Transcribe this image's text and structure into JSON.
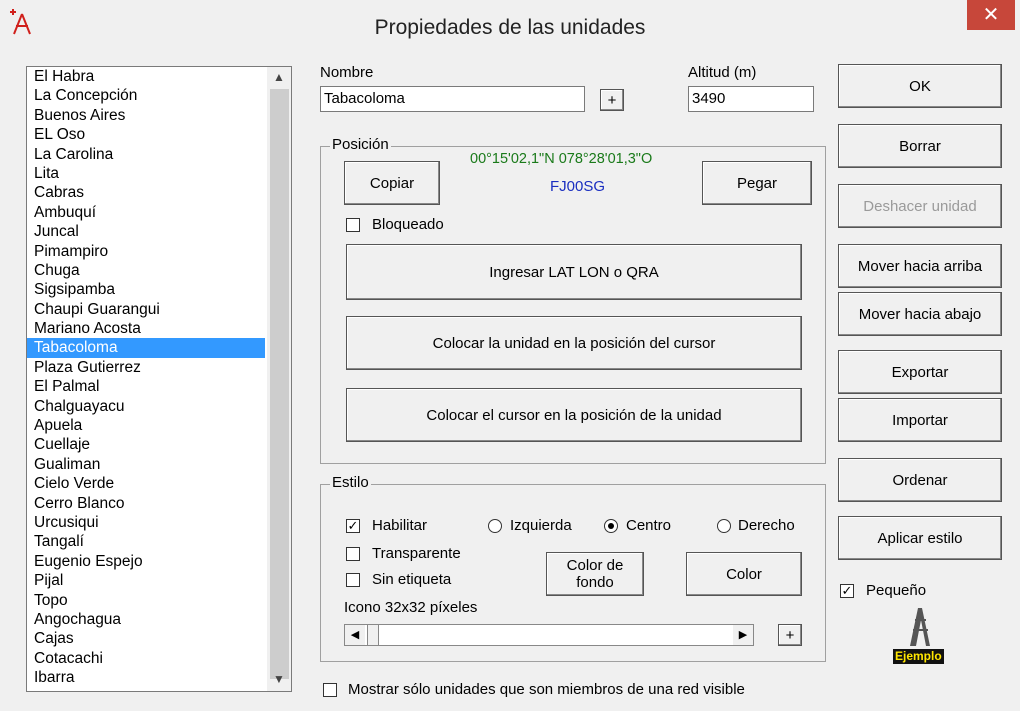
{
  "window": {
    "title": "Propiedades de las unidades",
    "close_glyph": "✕"
  },
  "units_list": {
    "items": [
      "El Habra",
      "La Concepción",
      "Buenos Aires",
      "EL Oso",
      "La Carolina",
      "Lita",
      "Cabras",
      "Ambuquí",
      "Juncal",
      "Pimampiro",
      "Chuga",
      "Sigsipamba",
      "Chaupi Guarangui",
      "Mariano Acosta",
      "Tabacoloma",
      "Plaza Gutierrez",
      "El Palmal",
      "Chalguayacu",
      "Apuela",
      "Cuellaje",
      "Gualiman",
      "Cielo Verde",
      "Cerro Blanco",
      "Urcusiqui",
      "Tangalí",
      "Eugenio Espejo",
      "Pijal",
      "Topo",
      "Angochagua",
      "Cajas",
      "Cotacachi",
      "Ibarra"
    ],
    "selected": "Tabacoloma"
  },
  "fields": {
    "nombre_label": "Nombre",
    "nombre_value": "Tabacoloma",
    "plus_label": "+",
    "altitud_label": "Altitud (m)",
    "altitud_value": "3490"
  },
  "posicion": {
    "title": "Posición",
    "coords": "00°15'02,1\"N 078°28'01,3\"O",
    "qra": "FJ00SG",
    "copiar": "Copiar",
    "pegar": "Pegar",
    "bloqueado": "Bloqueado",
    "ingresar": "Ingresar LAT LON o QRA",
    "colocar_unidad": "Colocar la unidad en la posición del cursor",
    "colocar_cursor": "Colocar el cursor en la posición de la unidad"
  },
  "estilo": {
    "title": "Estilo",
    "habilitar": "Habilitar",
    "izquierda": "Izquierda",
    "centro": "Centro",
    "derecho": "Derecho",
    "transparente": "Transparente",
    "sin_etiqueta": "Sin etiqueta",
    "color_fondo_1": "Color de",
    "color_fondo_2": "fondo",
    "color": "Color",
    "icono": "Icono 32x32 píxeles",
    "plus": "+",
    "alignment": "Centro"
  },
  "right_buttons": {
    "ok": "OK",
    "borrar": "Borrar",
    "deshacer": "Deshacer unidad",
    "mover_arriba": "Mover hacia arriba",
    "mover_abajo": "Mover hacia abajo",
    "exportar": "Exportar",
    "importar": "Importar",
    "ordenar": "Ordenar",
    "aplicar": "Aplicar estilo",
    "pequeno": "Pequeño",
    "ejemplo": "Ejemplo"
  },
  "footer": {
    "mostrar": "Mostrar sólo unidades que son miembros de una red visible"
  },
  "icons": {
    "app": "antenna-icon",
    "tower": "tower-icon"
  },
  "colors": {
    "selection": "#3399ff",
    "close": "#c7473a",
    "coords": "#1a7a1a",
    "qra": "#1a2ec0"
  }
}
